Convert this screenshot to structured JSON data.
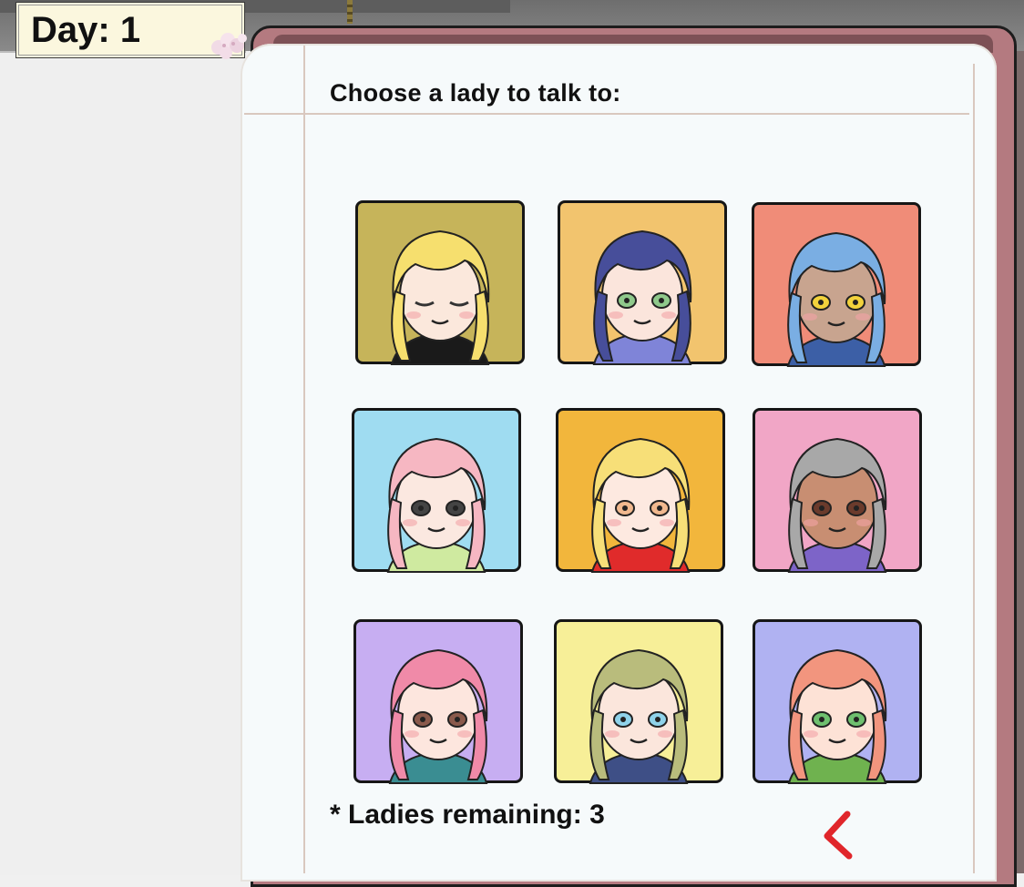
{
  "hud": {
    "day_label": "Day: 1"
  },
  "notebook": {
    "prompt": "Choose a lady to talk to:",
    "remaining_label": "* Ladies remaining: 3"
  },
  "portraits": [
    {
      "id": "lady-1",
      "bg": "#c6b45a",
      "hair": "#f6df6e",
      "skin": "#fbe8dc",
      "eyes": "closed",
      "eye_color": "#333333",
      "accent": "#1a1a1a"
    },
    {
      "id": "lady-2",
      "bg": "#f2c46e",
      "hair": "#474e9a",
      "skin": "#fbe5dc",
      "eyes": "open",
      "eye_color": "#8fc98b",
      "accent": "#7f84d8"
    },
    {
      "id": "lady-3",
      "bg": "#f08c78",
      "hair": "#7aaee3",
      "skin": "#c8a48f",
      "eyes": "open",
      "eye_color": "#f2d23c",
      "accent": "#3c5fa6"
    },
    {
      "id": "lady-4",
      "bg": "#9fdcf1",
      "hair": "#f6b7c2",
      "skin": "#fbe8e0",
      "eyes": "open",
      "eye_color": "#444444",
      "accent": "#cfeaa0"
    },
    {
      "id": "lady-5",
      "bg": "#f2b63c",
      "hair": "#f7df78",
      "skin": "#fde9e0",
      "eyes": "open",
      "eye_color": "#f1b98f",
      "accent": "#e02b2b"
    },
    {
      "id": "lady-6",
      "bg": "#f1a6c6",
      "hair": "#a8a8a8",
      "skin": "#c88e72",
      "eyes": "open",
      "eye_color": "#6b3b2c",
      "accent": "#7d64c8"
    },
    {
      "id": "lady-7",
      "bg": "#c7aef2",
      "hair": "#f08aa8",
      "skin": "#fde6de",
      "eyes": "open",
      "eye_color": "#8a5a4c",
      "accent": "#3a8d92"
    },
    {
      "id": "lady-8",
      "bg": "#f7ef98",
      "hair": "#b9bc7c",
      "skin": "#fbe6dc",
      "eyes": "open",
      "eye_color": "#8fd3ea",
      "accent": "#3e4f86"
    },
    {
      "id": "lady-9",
      "bg": "#b0b2f2",
      "hair": "#f2957e",
      "skin": "#fde2d6",
      "eyes": "open",
      "eye_color": "#6fc06f",
      "accent": "#6fb24f"
    }
  ],
  "colors": {
    "cover": "#b47a80",
    "page": "#f6fafb",
    "day_box": "#fbf7de",
    "back_arrow": "#e0262b"
  },
  "icons": {
    "back": "back-arrow-icon"
  }
}
